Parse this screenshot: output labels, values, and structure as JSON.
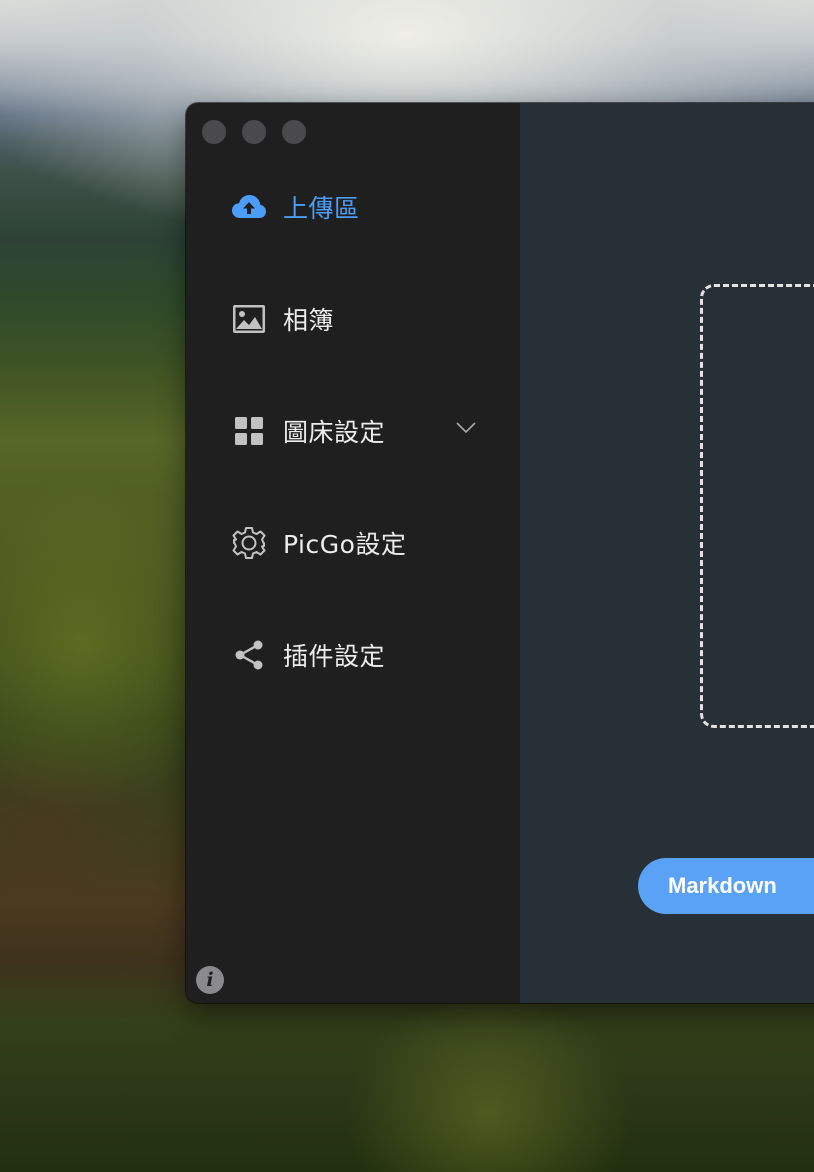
{
  "window": {
    "controls": [
      "close",
      "minimize",
      "maximize"
    ]
  },
  "sidebar": {
    "items": [
      {
        "label": "上傳區",
        "icon": "cloud-upload-icon",
        "active": true
      },
      {
        "label": "相簿",
        "icon": "image-icon",
        "active": false
      },
      {
        "label": "圖床設定",
        "icon": "grid-icon",
        "active": false,
        "expandable": true
      },
      {
        "label": "PicGo設定",
        "icon": "gear-icon",
        "active": false
      },
      {
        "label": "插件設定",
        "icon": "share-icon",
        "active": false
      }
    ],
    "info_icon": "info-icon"
  },
  "main": {
    "link_format_button": "Markdown"
  },
  "colors": {
    "accent": "#4c9df7",
    "button": "#5aa2f6",
    "sidebar_bg": "#1f1f20",
    "main_bg": "#263036",
    "text": "#ececec"
  }
}
